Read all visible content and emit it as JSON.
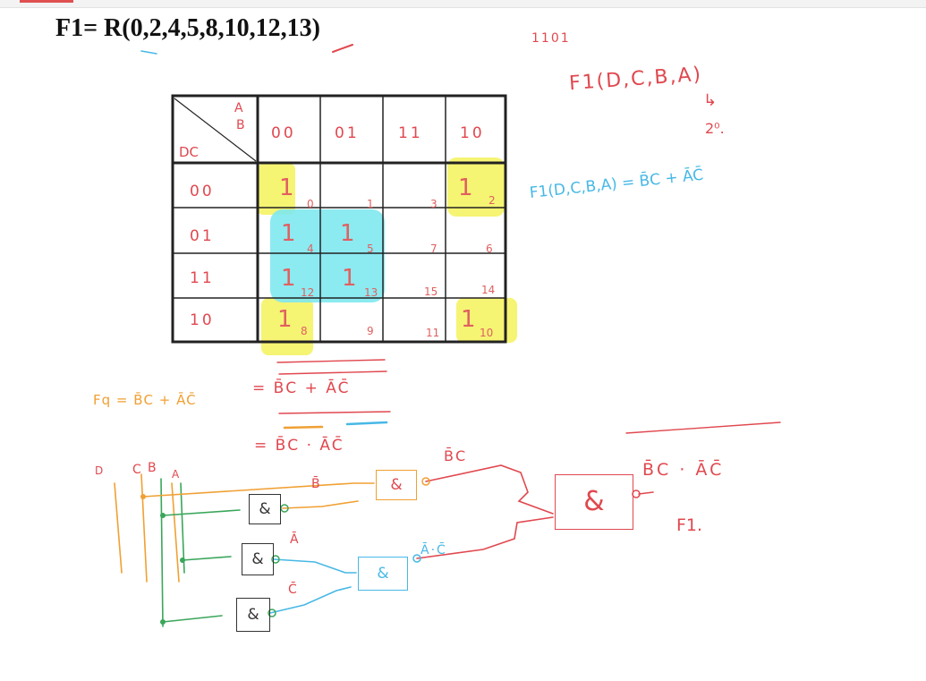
{
  "title": "F1= R(0,2,4,5,8,10,12,13)",
  "notes": {
    "note_1101": "1101",
    "f1_vars": "F1(D,C,B,A)",
    "arrow": "↳",
    "exp": "2⁰.",
    "f1_result": "F1(D,C,B,A) = B̄C + ĀC̄",
    "fq_eq": "Fq = B̄C + ĀC̄",
    "eq_double": "= B̄C + ĀC̄",
    "eq_nand": "= B̄C · ĀC̄"
  },
  "kmap": {
    "corner_top": "A",
    "corner_mid": "B",
    "corner_row": "DC",
    "col_headers": [
      "00",
      "01",
      "11",
      "10"
    ],
    "row_headers": [
      "00",
      "01",
      "11",
      "10"
    ],
    "cells": [
      [
        {
          "v": "1",
          "i": "0"
        },
        {
          "v": "",
          "i": "1"
        },
        {
          "v": "",
          "i": "3"
        },
        {
          "v": "1",
          "i": "2"
        }
      ],
      [
        {
          "v": "1",
          "i": "4"
        },
        {
          "v": "1",
          "i": "5"
        },
        {
          "v": "",
          "i": "7"
        },
        {
          "v": "",
          "i": "6"
        }
      ],
      [
        {
          "v": "1",
          "i": "12"
        },
        {
          "v": "1",
          "i": "13"
        },
        {
          "v": "",
          "i": "15"
        },
        {
          "v": "",
          "i": "14"
        }
      ],
      [
        {
          "v": "1",
          "i": "8"
        },
        {
          "v": "",
          "i": "9"
        },
        {
          "v": "",
          "i": "11"
        },
        {
          "v": "1",
          "i": "10"
        }
      ]
    ]
  },
  "circuit": {
    "inputs": [
      "D",
      "C",
      "B",
      "A"
    ],
    "gate_symbol": "&",
    "label_bbar": "B̄",
    "label_abar": "Ā",
    "label_cbar": "C̄",
    "label_bc": "B̄C",
    "label_ac": "Ā·C̄",
    "label_out": "B̄C · ĀC̄",
    "label_f1": "F1."
  },
  "colors": {
    "red": "#e0484f",
    "blue": "#47b8e6",
    "green": "#3aa65a",
    "orange": "#f0a033",
    "yellow_highlight": "#f4f25a",
    "cyan_highlight": "#7fe8f0"
  }
}
